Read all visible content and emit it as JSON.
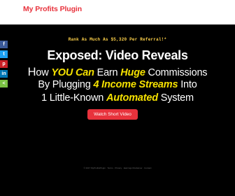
{
  "header": {
    "site_title": "My Profits Plugin"
  },
  "share": {
    "items": [
      {
        "name": "facebook",
        "glyph": "f",
        "color": "#3b5998"
      },
      {
        "name": "twitter",
        "glyph": "t",
        "color": "#1da1f2"
      },
      {
        "name": "pinterest",
        "glyph": "p",
        "color": "#cb2027"
      },
      {
        "name": "linkedin",
        "glyph": "in",
        "color": "#0077b5"
      },
      {
        "name": "share",
        "glyph": "<",
        "color": "#7ac143"
      }
    ]
  },
  "hero": {
    "tagline": "Rank As Much As $5,320 Per Referral!*",
    "headline": "Exposed: Video Reveals",
    "line2": {
      "cap": "H",
      "t1": "ow ",
      "e1": "YOU Can",
      "t2": " Earn ",
      "e2": "Huge",
      "t3": " Commissions"
    },
    "line3": {
      "t1": "By Plugging ",
      "e1": "4 Income Streams",
      "t2": " Into"
    },
    "line4": {
      "t1": "1 Little-Known ",
      "e1": "Automated",
      "t2": " System"
    },
    "cta_label": "Watch Short Video"
  },
  "footer": {
    "text": "© 2017 MyProfitsPlugin · Terms · Privacy · Earnings Disclaimer · Contact"
  },
  "colors": {
    "brand_red": "#e8323c",
    "emphasis_yellow": "#f5e100",
    "tagline_yellow": "#ffd24a",
    "hero_bg": "#000000"
  }
}
